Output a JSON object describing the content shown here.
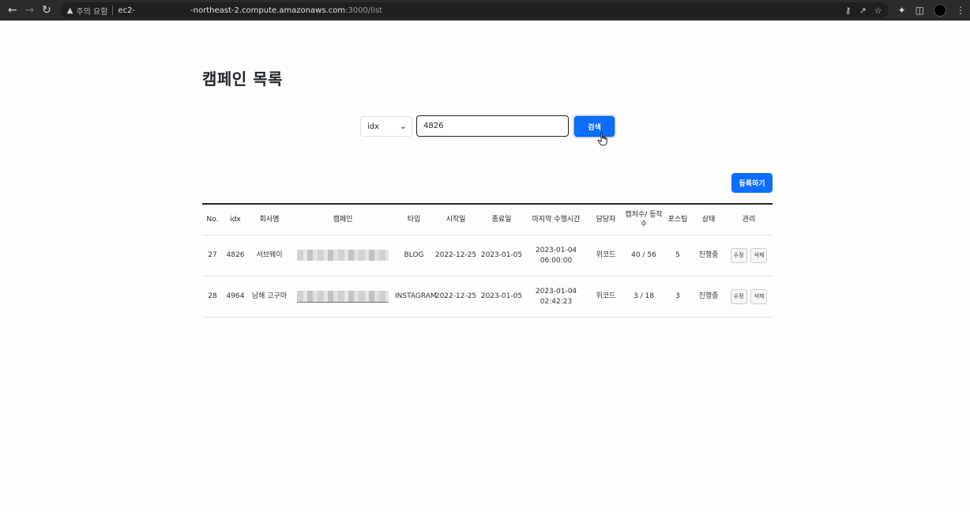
{
  "browser": {
    "warning_label": "주의 요함",
    "url_host_prefix": "ec2-",
    "url_host_rest": "-northeast-2.compute.amazonaws.com",
    "url_port_path": ":3000/list"
  },
  "page": {
    "title": "캠페인 목록"
  },
  "search": {
    "field_selected": "idx",
    "query_value": "4826",
    "button_label": "검색"
  },
  "register_button": "등록하기",
  "table": {
    "headers": [
      "No.",
      "idx",
      "회사명",
      "캠페인",
      "타입",
      "시작일",
      "종료일",
      "마지막 수행시간",
      "담당자",
      "캡처수/ 등작수",
      "포스팅",
      "상태",
      "관리"
    ],
    "rows": [
      {
        "no": "27",
        "idx": "4826",
        "company": "서브웨이",
        "type": "BLOG",
        "start": "2022-12-25",
        "end": "2023-01-05",
        "last_run_date": "2023-01-04",
        "last_run_time": "06:00:00",
        "manager": "위코드",
        "capture": "40 / 56",
        "posting": "5",
        "status": "진행중",
        "edit": "수정",
        "delete": "삭제"
      },
      {
        "no": "28",
        "idx": "4964",
        "company": "남해 고구마",
        "type": "INSTAGRAM",
        "start": "2022-12-25",
        "end": "2023-01-05",
        "last_run_date": "2023-01-04",
        "last_run_time": "02:42:23",
        "manager": "위코드",
        "capture": "3 / 18",
        "posting": "3",
        "status": "진행중",
        "edit": "수정",
        "delete": "삭제"
      }
    ]
  },
  "colors": {
    "primary": "#0d6efd",
    "chrome_bg": "#2b2b2d"
  }
}
